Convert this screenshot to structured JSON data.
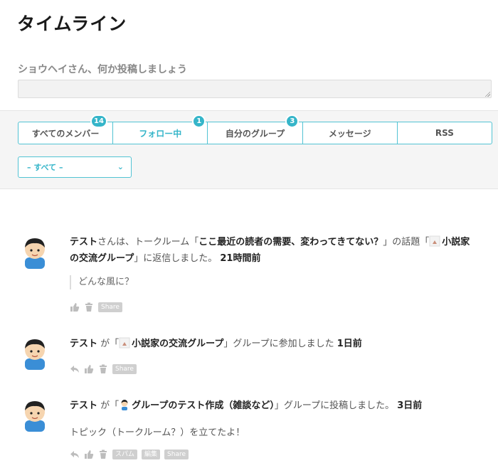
{
  "page": {
    "title": "タイムライン"
  },
  "post_form": {
    "prompt": "ショウヘイさん、何か投稿しましょう",
    "placeholder": ""
  },
  "tabs": [
    {
      "label": "すべてのメンバー",
      "badge": "14"
    },
    {
      "label": "フォロー中",
      "badge": "1"
    },
    {
      "label": "自分のグループ",
      "badge": "3"
    },
    {
      "label": "メッセージ"
    },
    {
      "label": "RSS"
    }
  ],
  "filter_select": {
    "value": "– すべて –"
  },
  "activities": [
    {
      "user": "テスト",
      "pre": "さんは、トークルーム「",
      "topic": "ここ最近の読者の需要、変わってきてない？",
      "mid": "」の話題「",
      "group": "小説家の交流グループ",
      "post": "」に返信しました。",
      "time": "21時間前",
      "quote": "どんな風に？",
      "tags": [
        "Share"
      ]
    },
    {
      "user": "テスト",
      "pre": " が「",
      "group": "小説家の交流グループ",
      "post": "」グループに参加しました",
      "time": "1日前",
      "tags": [
        "Share"
      ]
    },
    {
      "user": "テスト",
      "pre": " が「",
      "group": "グループのテスト作成（雑談など）",
      "post": "」グループに投稿しました。",
      "time": "3日前",
      "body": "トピック（トークルーム？）を立てたよ！",
      "tags": [
        "スパム",
        "編集",
        "Share"
      ]
    }
  ],
  "colors": {
    "accent": "#35b5c9",
    "tag": "#cfcfcf"
  }
}
